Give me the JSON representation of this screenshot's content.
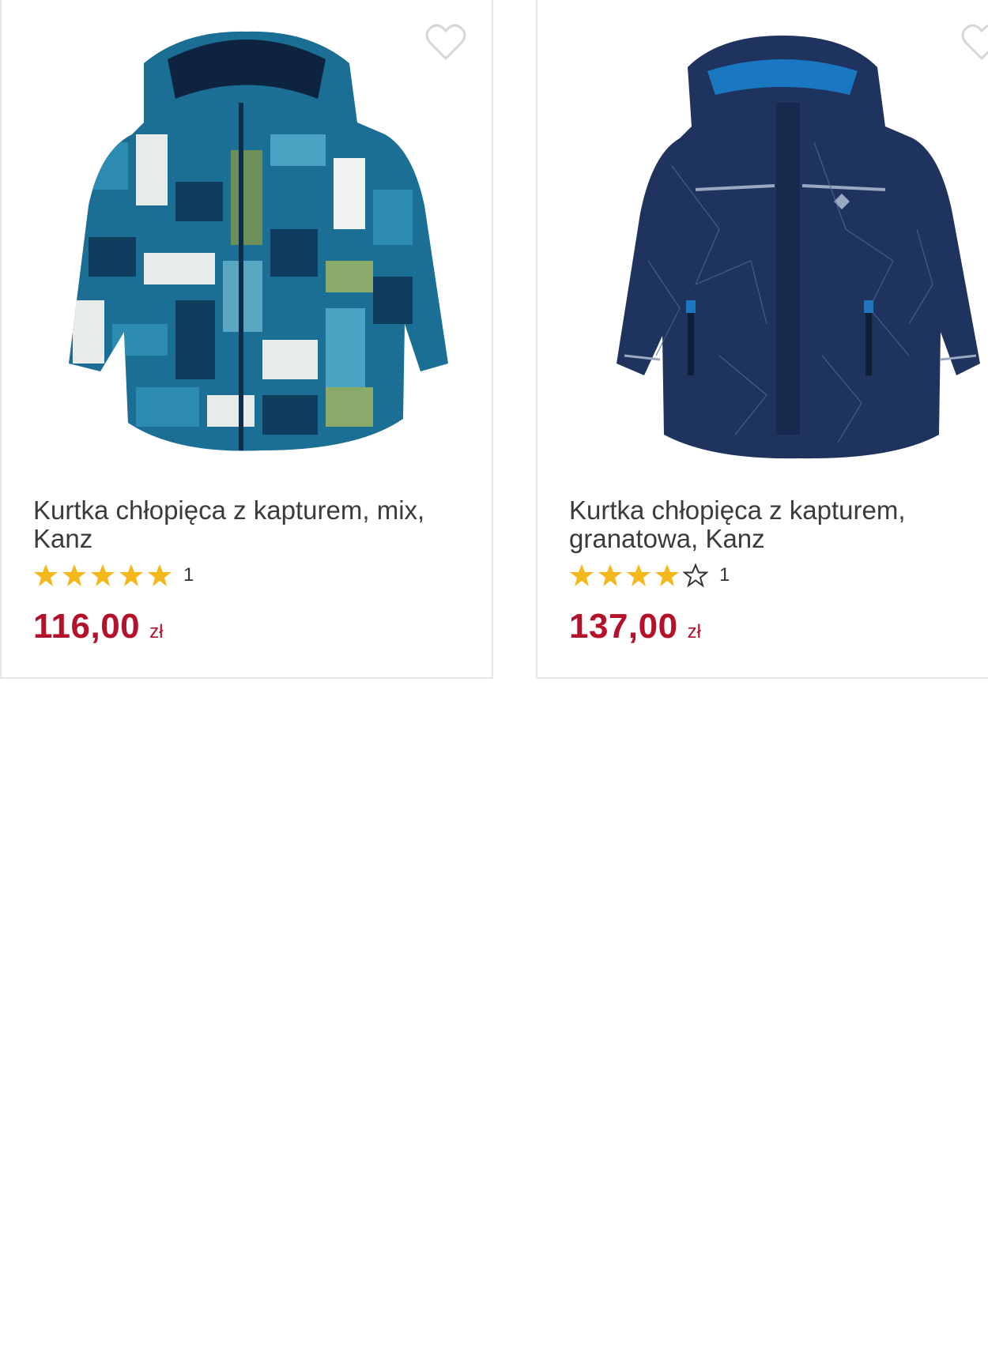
{
  "products": [
    {
      "title": "Kurtka chłopięca z kapturem, mix, Kanz",
      "rating": 5,
      "rating_max": 5,
      "rating_count": "1",
      "price": "116,00",
      "currency": "zł",
      "image": "mix-print-hooded-jacket"
    },
    {
      "title": "Kurtka chłopięca z kapturem, granatowa, Kanz",
      "rating": 4,
      "rating_max": 5,
      "rating_count": "1",
      "price": "137,00",
      "currency": "zł",
      "image": "navy-hooded-jacket"
    }
  ],
  "colors": {
    "price": "#b3122a",
    "star": "#f4b81c",
    "border": "#e6e6e6",
    "title": "#3b3b3b"
  },
  "icons": {
    "favorite": "heart-outline-icon",
    "star_full": "star-filled-icon",
    "star_empty": "star-outline-icon"
  }
}
